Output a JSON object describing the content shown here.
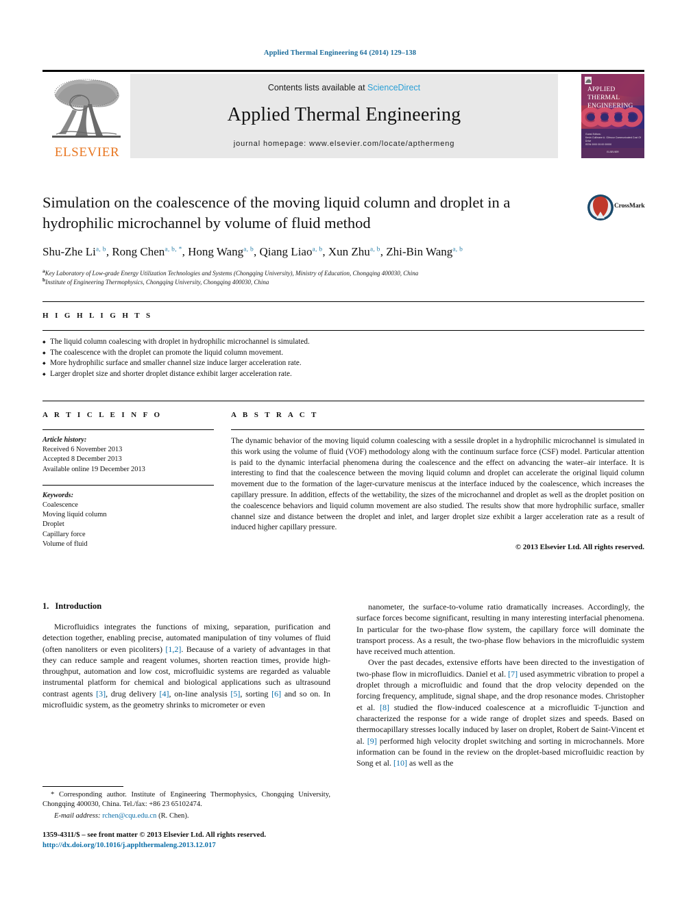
{
  "running_head": "Applied Thermal Engineering 64 (2014) 129–138",
  "masthead": {
    "contents_prefix": "Contents lists available at ",
    "sciencedirect": "ScienceDirect",
    "journal_name": "Applied Thermal Engineering",
    "homepage": "journal homepage: www.elsevier.com/locate/apthermeng",
    "publisher_wordmark": "ELSEVIER",
    "cover": {
      "line1": "APPLIED",
      "line2": "THERMAL",
      "line3": "ENGINEERING",
      "footer_line1": "Guest Editors:",
      "footer_line2": "Kevin Cullinane   A. Gilmour   Communicated Cost Of Drive",
      "footer_line3": "ISSN   0000   00:00   00000",
      "bottom": "ELSEVIER"
    },
    "accent_blue": "#2a9fd6",
    "elsevier_orange": "#E87722"
  },
  "title": "Simulation on the coalescence of the moving liquid column and droplet in a hydrophilic microchannel by volume of fluid method",
  "crossmark": {
    "label": "CrossMark"
  },
  "authors": [
    {
      "name": "Shu-Zhe Li",
      "sup": "a, b"
    },
    {
      "name": "Rong Chen",
      "sup": "a, b, *"
    },
    {
      "name": "Hong Wang",
      "sup": "a, b"
    },
    {
      "name": "Qiang Liao",
      "sup": "a, b"
    },
    {
      "name": "Xun Zhu",
      "sup": "a, b"
    },
    {
      "name": "Zhi-Bin Wang",
      "sup": "a, b"
    }
  ],
  "affiliations": [
    {
      "mark": "a",
      "text": "Key Laboratory of Low-grade Energy Utilization Technologies and Systems (Chongqing University), Ministry of Education, Chongqing 400030, China"
    },
    {
      "mark": "b",
      "text": "Institute of Engineering Thermophysics, Chongqing University, Chongqing 400030, China"
    }
  ],
  "highlights": {
    "heading": "H I G H L I G H T S",
    "items": [
      "The liquid column coalescing with droplet in hydrophilic microchannel is simulated.",
      "The coalescence with the droplet can promote the liquid column movement.",
      "More hydrophilic surface and smaller channel size induce larger acceleration rate.",
      "Larger droplet size and shorter droplet distance exhibit larger acceleration rate."
    ]
  },
  "article_info": {
    "heading": "A R T I C L E   I N F O",
    "history_label": "Article history:",
    "history": [
      "Received 6 November 2013",
      "Accepted 8 December 2013",
      "Available online 19 December 2013"
    ],
    "keywords_label": "Keywords:",
    "keywords": [
      "Coalescence",
      "Moving liquid column",
      "Droplet",
      "Capillary force",
      "Volume of fluid"
    ]
  },
  "abstract": {
    "heading": "A B S T R A C T",
    "text": "The dynamic behavior of the moving liquid column coalescing with a sessile droplet in a hydrophilic microchannel is simulated in this work using the volume of fluid (VOF) methodology along with the continuum surface force (CSF) model. Particular attention is paid to the dynamic interfacial phenomena during the coalescence and the effect on advancing the water–air interface. It is interesting to find that the coalescence between the moving liquid column and droplet can accelerate the original liquid column movement due to the formation of the lager-curvature meniscus at the interface induced by the coalescence, which increases the capillary pressure. In addition, effects of the wettability, the sizes of the microchannel and droplet as well as the droplet position on the coalescence behaviors and liquid column movement are also studied. The results show that more hydrophilic surface, smaller channel size and distance between the droplet and inlet, and larger droplet size exhibit a larger acceleration rate as a result of induced higher capillary pressure.",
    "copyright": "© 2013 Elsevier Ltd. All rights reserved."
  },
  "body": {
    "section_number": "1.",
    "section_title": "Introduction",
    "left_paragraph_1_a": "Microfluidics integrates the functions of mixing, separation, purification and detection together, enabling precise, automated manipulation of tiny volumes of fluid (often nanoliters or even picoliters) ",
    "left_ref_12": "[1,2]",
    "left_paragraph_1_b": ". Because of a variety of advantages in that they can reduce sample and reagent volumes, shorten reaction times, provide high-throughput, automation and low cost, microfluidic systems are regarded as valuable instrumental platform for chemical and biological applications such as ultrasound contrast agents ",
    "left_ref_3": "[3]",
    "left_paragraph_1_c": ", drug delivery ",
    "left_ref_4": "[4]",
    "left_paragraph_1_d": ", on-line analysis ",
    "left_ref_5": "[5]",
    "left_paragraph_1_e": ", sorting ",
    "left_ref_6": "[6]",
    "left_paragraph_1_f": " and so on. In microfluidic system, as the geometry shrinks to micrometer or even",
    "right_paragraph_1": "nanometer, the surface-to-volume ratio dramatically increases. Accordingly, the surface forces become significant, resulting in many interesting interfacial phenomena. In particular for the two-phase flow system, the capillary force will dominate the transport process. As a result, the two-phase flow behaviors in the microfluidic system have received much attention.",
    "right_paragraph_2_a": "Over the past decades, extensive efforts have been directed to the investigation of two-phase flow in microfluidics. Daniel et al. ",
    "right_ref_7": "[7]",
    "right_paragraph_2_b": " used asymmetric vibration to propel a droplet through a microfluidic and found that the drop velocity depended on the forcing frequency, amplitude, signal shape, and the drop resonance modes. Christopher et al. ",
    "right_ref_8": "[8]",
    "right_paragraph_2_c": " studied the flow-induced coalescence at a microfluidic T-junction and characterized the response for a wide range of droplet sizes and speeds. Based on thermocapillary stresses locally induced by laser on droplet, Robert de Saint-Vincent et al. ",
    "right_ref_9": "[9]",
    "right_paragraph_2_d": " performed high velocity droplet switching and sorting in microchannels. More information can be found in the review on the droplet-based microfluidic reaction by Song et al. ",
    "right_ref_10": "[10]",
    "right_paragraph_2_e": " as well as the"
  },
  "footnote": {
    "star_line": "* Corresponding author. Institute of Engineering Thermophysics, Chongqing University, Chongqing 400030, China. Tel./fax: +86 23 65102474.",
    "email_label": "E-mail address:",
    "email": "rchen@cqu.edu.cn",
    "email_suffix": "(R. Chen)."
  },
  "colophon": {
    "issn_line": "1359-4311/$ – see front matter © 2013 Elsevier Ltd. All rights reserved.",
    "doi": "http://dx.doi.org/10.1016/j.applthermaleng.2013.12.017"
  }
}
